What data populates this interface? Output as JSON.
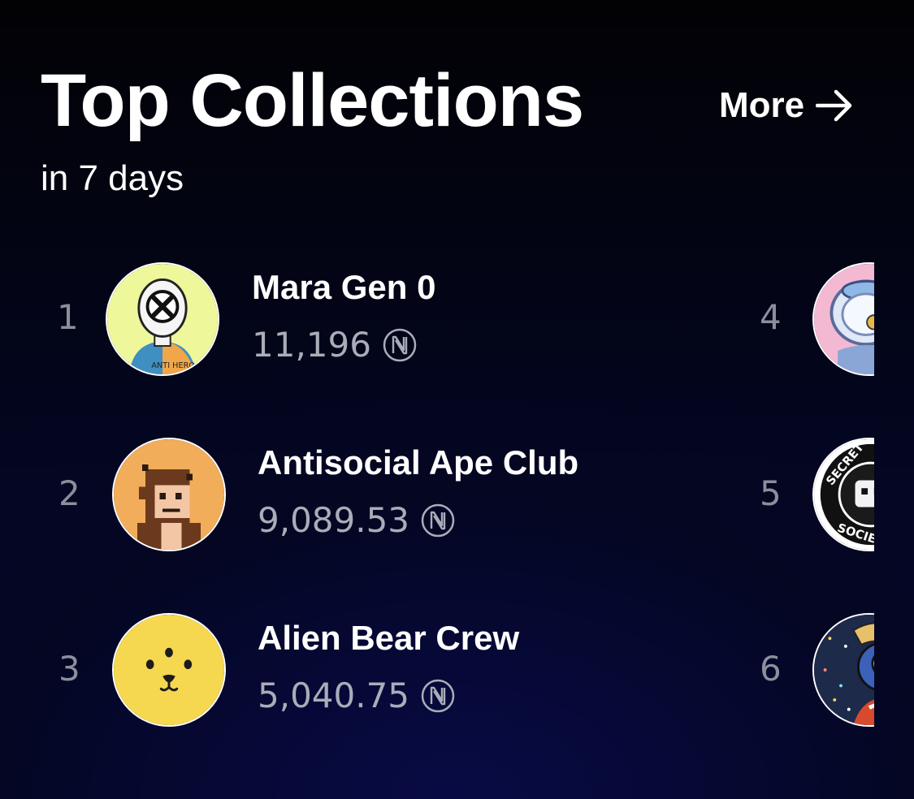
{
  "header": {
    "title": "Top Collections",
    "subtitle": "in 7 days",
    "more_label": "More"
  },
  "collections": [
    {
      "rank": "1",
      "name": "Mara Gen 0",
      "value": "11,196",
      "avatar": "mara-avatar"
    },
    {
      "rank": "2",
      "name": "Antisocial Ape Club",
      "value": "9,089.53",
      "avatar": "ape-avatar"
    },
    {
      "rank": "3",
      "name": "Alien Bear Crew",
      "value": "5,040.75",
      "avatar": "alien-bear-avatar"
    },
    {
      "rank": "4",
      "name": "",
      "value": "",
      "avatar": "astronaut-avatar"
    },
    {
      "rank": "5",
      "name": "",
      "value": "",
      "avatar": "secret-skull-society-avatar"
    },
    {
      "rank": "6",
      "name": "",
      "value": "",
      "avatar": "robot-avatar"
    }
  ],
  "icons": {
    "currency": "near-icon",
    "more_arrow": "arrow-right-icon"
  },
  "colors": {
    "background_top": "#020205",
    "background_bottom": "#050838",
    "rank_text": "#8a8f9c",
    "value_text": "#a9adb8"
  }
}
